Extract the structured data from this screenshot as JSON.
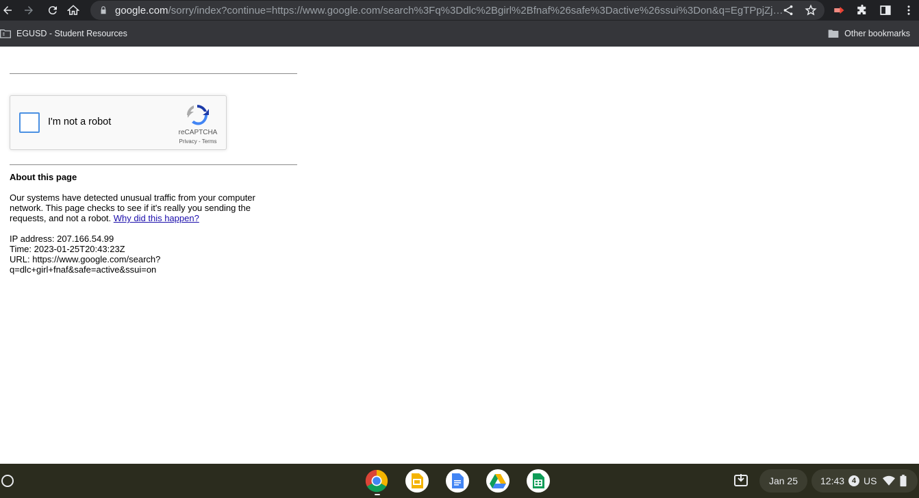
{
  "browser": {
    "url_host": "google.com",
    "url_rest": "/sorry/index?continue=https://www.google.com/search%3Fq%3Ddlc%2Bgirl%2Bfnaf%26safe%3Dactive%26ssui%3Don&q=EgTPpjZjG..."
  },
  "bookmarks": {
    "left_label": "EGUSD - Student Resources",
    "right_label": "Other bookmarks"
  },
  "captcha": {
    "label": "I'm not a robot",
    "brand": "reCAPTCHA",
    "links": "Privacy - Terms"
  },
  "about": {
    "title": "About this page",
    "text": "Our systems have detected unusual traffic from your computer network. This page checks to see if it's really you sending the requests, and not a robot.",
    "link_text": "Why did this happen?"
  },
  "meta": {
    "ip_line": "IP address: 207.166.54.99",
    "time_line": "Time: 2023-01-25T20:43:23Z",
    "url_line1": "URL: https://www.google.com/search?",
    "url_line2": "q=dlc+girl+fnaf&safe=active&ssui=on"
  },
  "shelf": {
    "date": "Jan 25",
    "time": "12:43",
    "notification_count": "4",
    "ime": "US",
    "apps": [
      "chrome-icon",
      "slides-icon",
      "docs-icon",
      "drive-icon",
      "sheets-icon"
    ]
  }
}
